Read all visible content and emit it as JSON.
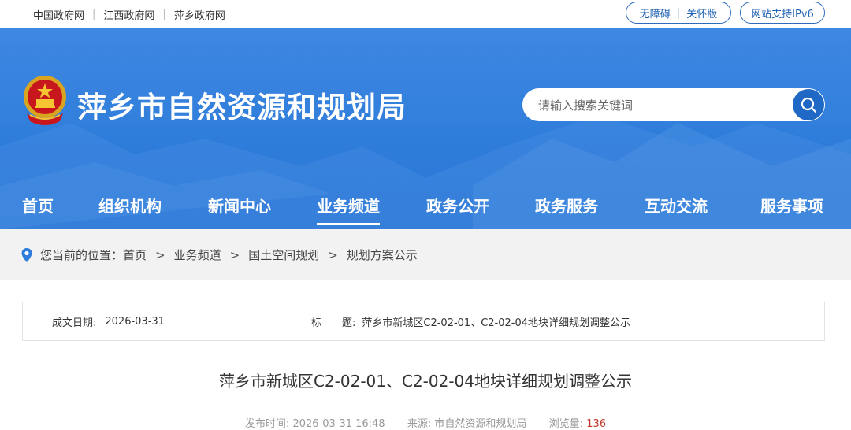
{
  "topbar": {
    "links": [
      "中国政府网",
      "江西政府网",
      "萍乡政府网"
    ],
    "accessibility": "无障碍",
    "elder": "关怀版",
    "ipv6": "网站支持IPv6"
  },
  "header": {
    "site_title": "萍乡市自然资源和规划局",
    "search_placeholder": "请输入搜索关键词",
    "colors": {
      "header_bg": "#2f7ddb",
      "search_btn": "#1f68c5"
    }
  },
  "nav": {
    "items": [
      "首页",
      "组织机构",
      "新闻中心",
      "业务频道",
      "政务公开",
      "政务服务",
      "互动交流",
      "服务事项"
    ],
    "active": "业务频道"
  },
  "breadcrumb": {
    "prefix": "您当前的位置：",
    "items": [
      "首页",
      "业务频道",
      "国土空间规划",
      "规划方案公示"
    ],
    "separator": ">"
  },
  "info": {
    "date_label": "成文日期:",
    "date_value": "2026-03-31",
    "title_label": "标　　题:",
    "title_value": "萍乡市新城区C2-02-01、C2-02-04地块详细规划调整公示"
  },
  "article": {
    "title": "萍乡市新城区C2-02-01、C2-02-04地块详细规划调整公示",
    "publish_label": "发布时间:",
    "publish_time": "2026-03-31 16:48",
    "source_label": "来源:",
    "source": "市自然资源和规划局",
    "views_label": "浏览量:",
    "views": "136"
  }
}
